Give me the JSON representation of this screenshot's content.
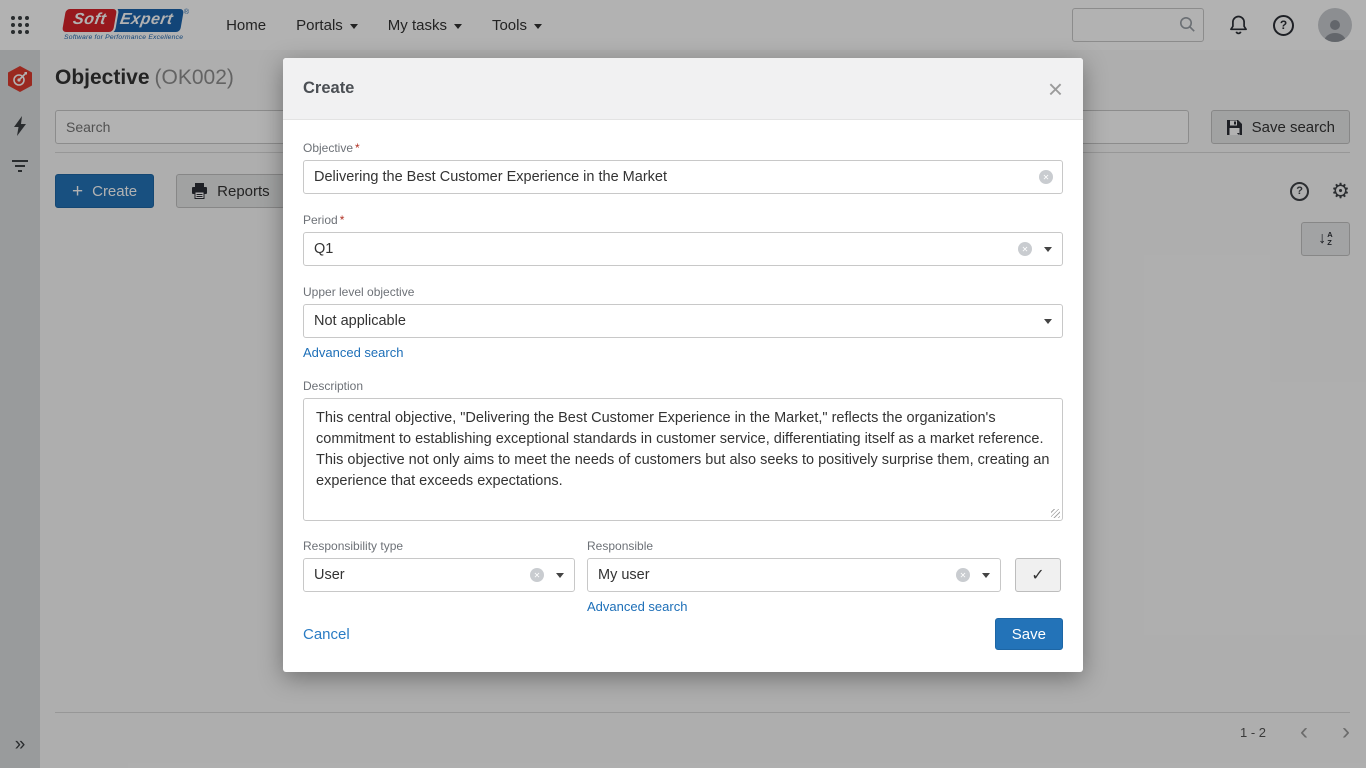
{
  "topbar": {
    "logo": {
      "soft": "Soft",
      "expert": "Expert",
      "reg": "®",
      "tagline": "Software for Performance Excellence"
    },
    "menu": [
      {
        "label": "Home"
      },
      {
        "label": "Portals"
      },
      {
        "label": "My tasks"
      },
      {
        "label": "Tools"
      }
    ],
    "search_value": ""
  },
  "sidebar": {
    "app_icon": "objective-module-icon",
    "icons": [
      "lightning-icon",
      "filter-icon"
    ],
    "expand_glyph": "»"
  },
  "page": {
    "title": "Objective",
    "code": "(OK002)",
    "search_placeholder": "Search",
    "save_search_label": "Save search",
    "create_label": "Create",
    "reports_label": "Reports",
    "pagination_range": "1 - 2"
  },
  "glyphs": {
    "plus": "+",
    "close": "×",
    "clear": "✕",
    "check": "✓",
    "question": "?",
    "gear": "⚙",
    "chevron_left": "‹",
    "chevron_right": "›",
    "expand": "»",
    "sort_arrow": "↓",
    "sort_a": "A",
    "sort_z": "Z",
    "required": "*"
  },
  "modal": {
    "title": "Create",
    "fields": {
      "objective": {
        "label": "Objective",
        "value": "Delivering the Best Customer Experience in the Market"
      },
      "period": {
        "label": "Period",
        "value": "Q1"
      },
      "upper_level": {
        "label": "Upper level objective",
        "value": "Not applicable",
        "advanced_search": "Advanced search"
      },
      "description": {
        "label": "Description",
        "value": "This central objective, \"Delivering the Best Customer Experience in the Market,\" reflects the organization's commitment to establishing exceptional standards in customer service, differentiating itself as a market reference. This objective not only aims to meet the needs of customers but also seeks to positively surprise them, creating an experience that exceeds expectations."
      },
      "responsibility_type": {
        "label": "Responsibility type",
        "value": "User"
      },
      "responsible": {
        "label": "Responsible",
        "value": "My user",
        "advanced_search": "Advanced search"
      }
    },
    "cancel_label": "Cancel",
    "save_label": "Save"
  },
  "colors": {
    "accent_blue": "#2373b8",
    "logo_red": "#d8232a",
    "logo_blue": "#1b63ac",
    "required_red": "#b03023",
    "overlay": "rgba(0,0,0,0.30)"
  }
}
